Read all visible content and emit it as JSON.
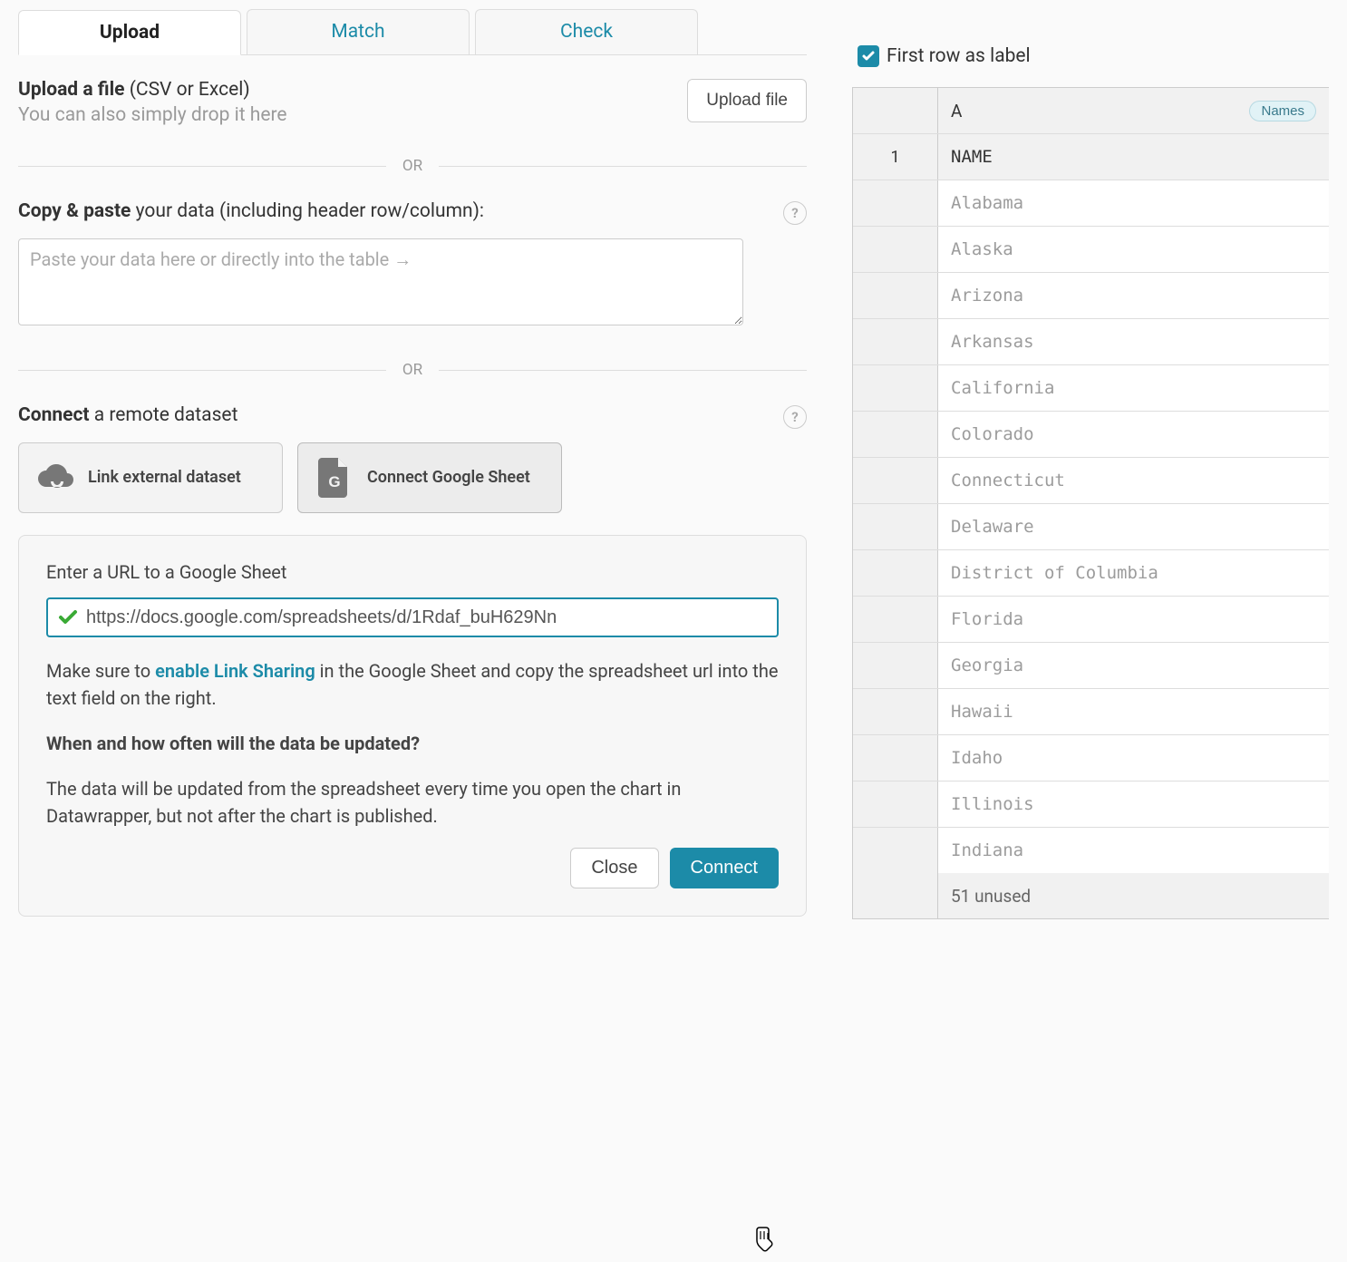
{
  "tabs": [
    "Upload",
    "Match",
    "Check"
  ],
  "upload": {
    "title_bold": "Upload a file",
    "title_rest": " (CSV or Excel)",
    "subtitle": "You can also simply drop it here",
    "button": "Upload file"
  },
  "divider_or": "OR",
  "paste": {
    "label_bold": "Copy & paste",
    "label_rest": " your data (including header row/column):",
    "placeholder": "Paste your data here or directly into the table →"
  },
  "connect": {
    "label_bold": "Connect",
    "label_rest": " a remote dataset",
    "btn1": "Link external dataset",
    "btn2": "Connect Google Sheet"
  },
  "panel": {
    "url_label": "Enter a URL to a Google Sheet",
    "url_value": "https://docs.google.com/spreadsheets/d/1Rdaf_buH629Nn",
    "hint_pre": "Make sure to ",
    "hint_link": "enable Link Sharing",
    "hint_post": " in the Google Sheet and copy the spreadsheet url into the text field on the right.",
    "q": "When and how often will the data be updated?",
    "a": "The data will be updated from the spreadsheet every time you open the chart in Datawrapper, but not after the chart is published.",
    "close": "Close",
    "connect": "Connect"
  },
  "right": {
    "checkbox_label": "First row as label",
    "col_letter": "A",
    "col_badge": "Names",
    "row1_num": "1",
    "row1_head": "NAME",
    "rows": [
      "Alabama",
      "Alaska",
      "Arizona",
      "Arkansas",
      "California",
      "Colorado",
      "Connecticut",
      "Delaware",
      "District of Columbia",
      "Florida",
      "Georgia",
      "Hawaii",
      "Idaho",
      "Illinois",
      "Indiana"
    ],
    "unused": "51 unused"
  }
}
